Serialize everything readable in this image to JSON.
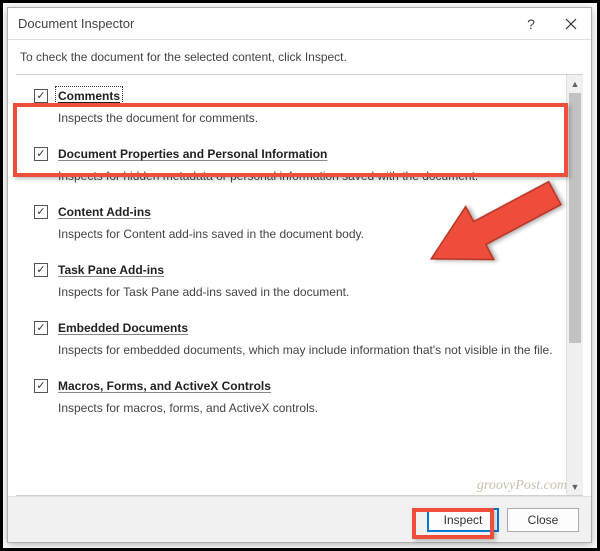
{
  "titlebar": {
    "title": "Document Inspector"
  },
  "instruction": "To check the document for the selected content, click Inspect.",
  "items": [
    {
      "title": "Comments",
      "desc": "Inspects the document for comments."
    },
    {
      "title": "Document Properties and Personal Information",
      "desc": "Inspects for hidden metadata or personal information saved with the document."
    },
    {
      "title": "Content Add-ins",
      "desc": "Inspects for Content add-ins saved in the document body."
    },
    {
      "title": "Task Pane Add-ins",
      "desc": "Inspects for Task Pane add-ins saved in the document."
    },
    {
      "title": "Embedded Documents",
      "desc": "Inspects for embedded documents, which may include information that's not visible in the file."
    },
    {
      "title": "Macros, Forms, and ActiveX Controls",
      "desc": "Inspects for macros, forms, and ActiveX controls."
    }
  ],
  "footer": {
    "inspect": "Inspect",
    "close": "Close"
  },
  "watermark": "groovyPost.com"
}
